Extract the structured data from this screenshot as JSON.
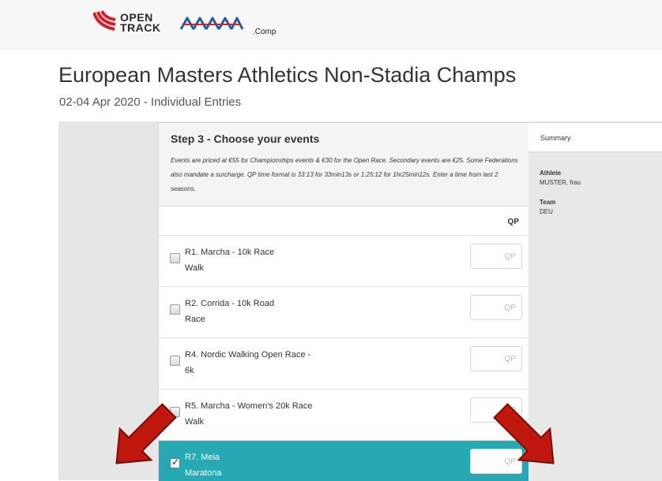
{
  "header": {
    "logo_text_line1": "OPEN",
    "logo_text_line2": "TRACK",
    "partner_logo": "EMA",
    "comp_text": ".Comp"
  },
  "page": {
    "title": "European Masters Athletics Non-Stadia Champs",
    "subtitle": "02-04 Apr 2020 - Individual Entries"
  },
  "step": {
    "title": "Step 3 - Choose your events",
    "description": "Events are priced at €55 for Championships events & €30 for the Open Race. Secondary events are €25. Some Federations also mandate a surcharge. QP time format is 33:13 for 33min13s or 1:25:12 for 1hr25min12s. Enter a time from last 2 seasons.",
    "qp_header": "QP"
  },
  "events": [
    {
      "line1": "R1. Marcha - 10k Race",
      "line2": "Walk",
      "checked": false,
      "qp_placeholder": "QP",
      "qp_value": ""
    },
    {
      "line1": "R2. Corrida - 10k Road",
      "line2": "Race",
      "checked": false,
      "qp_placeholder": "QP",
      "qp_value": ""
    },
    {
      "line1": "R4. Nordic Walking Open Race -",
      "line2": "6k",
      "checked": false,
      "qp_placeholder": "QP",
      "qp_value": ""
    },
    {
      "line1": "R5. Marcha - Women's 20k Race",
      "line2": "Walk",
      "checked": false,
      "qp_placeholder": "QP",
      "qp_value": ""
    },
    {
      "line1": "R7. Meia",
      "line2": "Maratona",
      "checked": true,
      "qp_placeholder": "QP",
      "qp_value": ""
    }
  ],
  "summary": {
    "title": "Summary",
    "athlete_label": "Athlete",
    "athlete_value": "MUSTER, frau",
    "team_label": "Team",
    "team_value": "DEU"
  },
  "colors": {
    "selected_row": "#27a9b4",
    "arrow": "#c0170f",
    "logo_red": "#d41e28",
    "logo_blue": "#1b5fa8"
  }
}
